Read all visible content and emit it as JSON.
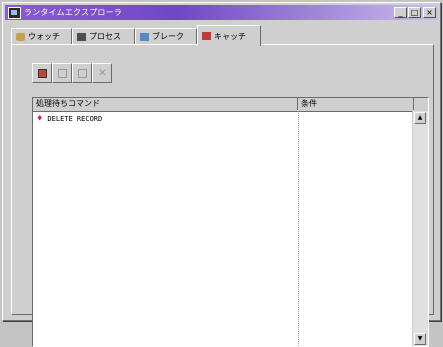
{
  "window": {
    "title": "ランタイムエクスプローラ",
    "buttons": {
      "minimize": "_",
      "maximize": "□",
      "close": "×"
    }
  },
  "tabs": [
    {
      "label": "ウォッチ",
      "icon": "watch-icon"
    },
    {
      "label": "プロセス",
      "icon": "process-icon"
    },
    {
      "label": "ブレーク",
      "icon": "breakpoint-icon"
    },
    {
      "label": "キャッチ",
      "icon": "catch-icon",
      "active": true
    }
  ],
  "toolbar": {
    "buttons": [
      {
        "name": "new-catch-button",
        "icon": "new-icon",
        "enabled": true
      },
      {
        "name": "edit-catch-button",
        "icon": "edit-icon",
        "enabled": false
      },
      {
        "name": "copy-catch-button",
        "icon": "copy-icon",
        "enabled": false
      },
      {
        "name": "delete-catch-button",
        "icon": "delete-icon",
        "enabled": false
      }
    ]
  },
  "list": {
    "columns": [
      "処理待ちコマンド",
      "条件"
    ],
    "rows": [
      {
        "command": "DELETE RECORD",
        "condition": "",
        "marker": "♦"
      }
    ]
  }
}
